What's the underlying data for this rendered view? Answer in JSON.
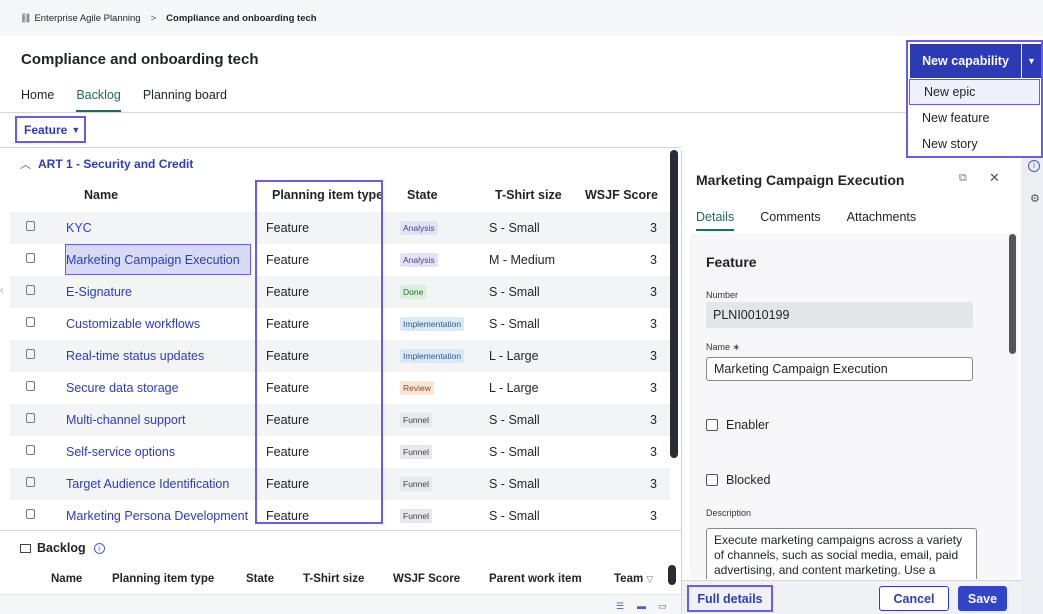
{
  "breadcrumb": {
    "root": "Enterprise Agile Planning",
    "separator": ">",
    "current": "Compliance and onboarding tech"
  },
  "page_title": "Compliance and onboarding tech",
  "tabs": [
    "Home",
    "Backlog",
    "Planning board"
  ],
  "filter": {
    "label": "Feature"
  },
  "new_capability": {
    "label": "New capability",
    "menu": [
      "New epic",
      "New feature",
      "New story"
    ]
  },
  "grid": {
    "group_label": "ART 1 - Security and Credit",
    "columns": [
      "Name",
      "Planning item type",
      "State",
      "T-Shirt size",
      "WSJF Score"
    ],
    "rows": [
      {
        "name": "KYC",
        "type": "Feature",
        "state": "Analysis",
        "size": "S - Small",
        "wsjf": "3"
      },
      {
        "name": "Marketing Campaign Execution",
        "type": "Feature",
        "state": "Analysis",
        "size": "M - Medium",
        "wsjf": "3"
      },
      {
        "name": "E-Signature",
        "type": "Feature",
        "state": "Done",
        "size": "S - Small",
        "wsjf": "3"
      },
      {
        "name": "Customizable workflows",
        "type": "Feature",
        "state": "Implementation",
        "size": "S - Small",
        "wsjf": "3"
      },
      {
        "name": "Real-time status updates",
        "type": "Feature",
        "state": "Implementation",
        "size": "L - Large",
        "wsjf": "3"
      },
      {
        "name": "Secure data storage",
        "type": "Feature",
        "state": "Review",
        "size": "L - Large",
        "wsjf": "3"
      },
      {
        "name": "Multi-channel support",
        "type": "Feature",
        "state": "Funnel",
        "size": "S - Small",
        "wsjf": "3"
      },
      {
        "name": "Self-service options",
        "type": "Feature",
        "state": "Funnel",
        "size": "S - Small",
        "wsjf": "3"
      },
      {
        "name": "Target Audience Identification",
        "type": "Feature",
        "state": "Funnel",
        "size": "S - Small",
        "wsjf": "3"
      },
      {
        "name": "Marketing Persona Development",
        "type": "Feature",
        "state": "Funnel",
        "size": "S - Small",
        "wsjf": "3"
      }
    ]
  },
  "state_colors": {
    "Analysis": {
      "bg": "#e6e2f5",
      "fg": "#4a3f8f"
    },
    "Done": {
      "bg": "#d9f0dc",
      "fg": "#2b6b35"
    },
    "Implementation": {
      "bg": "#dbe9f7",
      "fg": "#2f5b8f"
    },
    "Review": {
      "bg": "#fbe6d6",
      "fg": "#8a4a1f"
    },
    "Funnel": {
      "bg": "#e7e8ec",
      "fg": "#444"
    }
  },
  "backlog": {
    "title": "Backlog",
    "columns": [
      "Name",
      "Planning item type",
      "State",
      "T-Shirt size",
      "WSJF Score",
      "Parent work item",
      "Team"
    ]
  },
  "panel": {
    "title": "Marketing Campaign Execution",
    "tabs": [
      "Details",
      "Comments",
      "Attachments"
    ],
    "section": "Feature",
    "number_label": "Number",
    "number_value": "PLNI0010199",
    "name_label": "Name",
    "name_required": "∗",
    "name_value": "Marketing Campaign Execution",
    "enabler": "Enabler",
    "blocked": "Blocked",
    "description_label": "Description",
    "description": "Execute marketing campaigns across a variety of channels, such as social media, email, paid advertising, and content marketing. Use a",
    "full_details": "Full details",
    "cancel": "Cancel",
    "save": "Save"
  },
  "colors": {
    "accent": "#2b3bb5",
    "highlight": "#6b5ce7",
    "active_tab": "#1b6f52"
  }
}
